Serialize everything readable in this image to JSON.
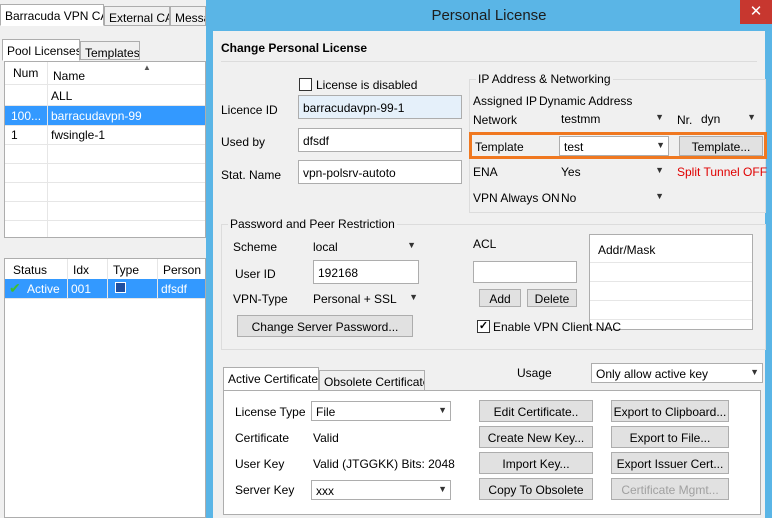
{
  "left_app": {
    "top_tabs": [
      "Barracuda VPN CA",
      "External CA",
      "Messa"
    ],
    "sub_tabs": [
      "Pool Licenses",
      "Templates"
    ],
    "pool_headers": [
      "Num",
      "Name"
    ],
    "pool_rows": [
      {
        "num": "",
        "name": "ALL"
      },
      {
        "num": "100...",
        "name": "barracudavpn-99"
      },
      {
        "num": "1",
        "name": "fwsingle-1"
      }
    ],
    "status_headers": [
      "Status",
      "Idx",
      "Type",
      "Person"
    ],
    "status_row": {
      "status": "Active",
      "idx": "001",
      "type_icon": "floppy-disk-icon",
      "person": "dfsdf"
    }
  },
  "dialog": {
    "title": "Personal License",
    "close": "✕",
    "heading": "Change Personal License",
    "license_disabled_label": "License is disabled",
    "licence_id_label": "Licence ID",
    "licence_id": "barracudavpn-99-1",
    "used_by_label": "Used  by",
    "used_by": "dfsdf",
    "stat_name_label": "Stat. Name",
    "stat_name": "vpn-polsrv-autoto",
    "ip_group_label": "IP Address & Networking",
    "assigned_ip_label": "Assigned IP",
    "assigned_ip_value": "Dynamic Address",
    "network_label": "Network",
    "network_value": "testmm",
    "nr_label": "Nr.",
    "nr_value": "dyn",
    "template_label": "Template",
    "template_value": "test",
    "template_button": "Template...",
    "ena_label": "ENA",
    "ena_value": "Yes",
    "split_tunnel": "Split Tunnel OFF",
    "vpn_always_on_label": "VPN Always ON",
    "vpn_always_on_value": "No",
    "pw_group_label": "Password and Peer Restriction",
    "scheme_label": "Scheme",
    "scheme_value": "local",
    "user_id_label": "User ID",
    "user_id_value": "192168",
    "vpn_type_label": "VPN-Type",
    "vpn_type_value": "Personal + SSL",
    "change_pw_button": "Change Server Password...",
    "acl_label": "ACL",
    "acl_value": "",
    "add_button": "Add",
    "delete_button": "Delete",
    "addr_mask_header": "Addr/Mask",
    "enable_nac_label": "Enable VPN Client NAC",
    "cert_tabs": [
      "Active Certificate",
      "Obsolete Certificate"
    ],
    "usage_label": "Usage",
    "usage_value": "Only allow active key",
    "license_type_label": "License Type",
    "license_type_value": "File",
    "certificate_label": "Certificate",
    "certificate_value": "Valid",
    "user_key_label": "User Key",
    "user_key_value": "Valid (JTGGKK) Bits: 2048",
    "server_key_label": "Server Key",
    "server_key_value": "xxx",
    "edit_cert_button": "Edit Certificate..",
    "create_key_button": "Create New Key...",
    "import_key_button": "Import Key...",
    "copy_obsolete_button": "Copy To Obsolete",
    "export_clipboard_button": "Export to Clipboard...",
    "export_file_button": "Export to File...",
    "export_issuer_button": "Export Issuer Cert...",
    "cert_mgmt_button": "Certificate Mgmt..."
  },
  "colors": {
    "title_bar": "#5ab5e6",
    "selection": "#3399ff",
    "highlight_box": "#f07820",
    "split_tunnel": "#e00000"
  }
}
